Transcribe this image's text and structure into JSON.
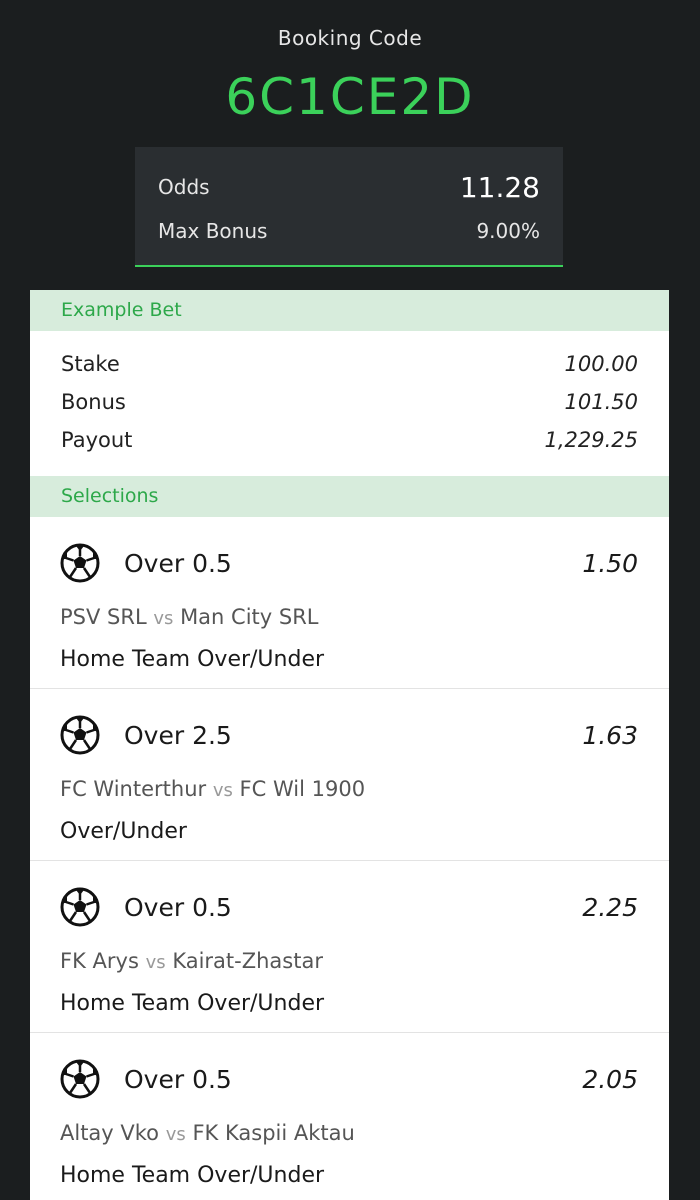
{
  "header": {
    "booking_label": "Booking Code",
    "booking_code": "6C1CE2D"
  },
  "odds_box": {
    "odds_label": "Odds",
    "odds_value": "11.28",
    "bonus_label": "Max Bonus",
    "bonus_value": "9.00%"
  },
  "example_bet": {
    "title": "Example Bet",
    "rows": [
      {
        "label": "Stake",
        "value": "100.00"
      },
      {
        "label": "Bonus",
        "value": "101.50"
      },
      {
        "label": "Payout",
        "value": "1,229.25"
      }
    ]
  },
  "selections": {
    "title": "Selections",
    "items": [
      {
        "pick": "Over 0.5",
        "odds": "1.50",
        "home": "PSV SRL",
        "vs": "vs",
        "away": "Man City SRL",
        "market": "Home Team Over/Under"
      },
      {
        "pick": "Over 2.5",
        "odds": "1.63",
        "home": "FC Winterthur",
        "vs": "vs",
        "away": "FC Wil 1900",
        "market": "Over/Under"
      },
      {
        "pick": "Over 0.5",
        "odds": "2.25",
        "home": "FK Arys",
        "vs": "vs",
        "away": "Kairat-Zhastar",
        "market": "Home Team Over/Under"
      },
      {
        "pick": "Over 0.5",
        "odds": "2.05",
        "home": "Altay Vko",
        "vs": "vs",
        "away": "FK Kaspii Aktau",
        "market": "Home Team Over/Under"
      }
    ]
  },
  "colors": {
    "background": "#1b1e1f",
    "accent": "#3bd15a",
    "section_header_bg": "#d7ecdc",
    "odds_box_bg": "#2a2e31"
  },
  "icons": {
    "selection_icon": "soccer-ball-icon"
  }
}
